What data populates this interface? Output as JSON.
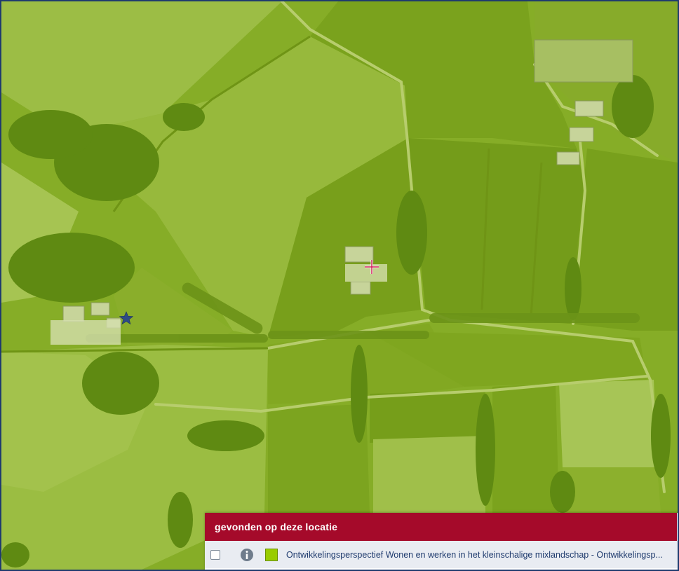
{
  "map": {
    "overlay_color": "#8db82a",
    "marker_star_icon": "star-icon",
    "marker_location_icon": "crosshair-icon"
  },
  "info_panel": {
    "title": "gevonden op deze locatie",
    "header_color": "#a50a2a",
    "rows": [
      {
        "checked": false,
        "info_icon": "info-icon",
        "swatch_color": "#99cc00",
        "label": "Ontwikkelingsperspectief Wonen en werken in het kleinschalige mixlandschap - Ontwikkelingsp..."
      }
    ]
  }
}
